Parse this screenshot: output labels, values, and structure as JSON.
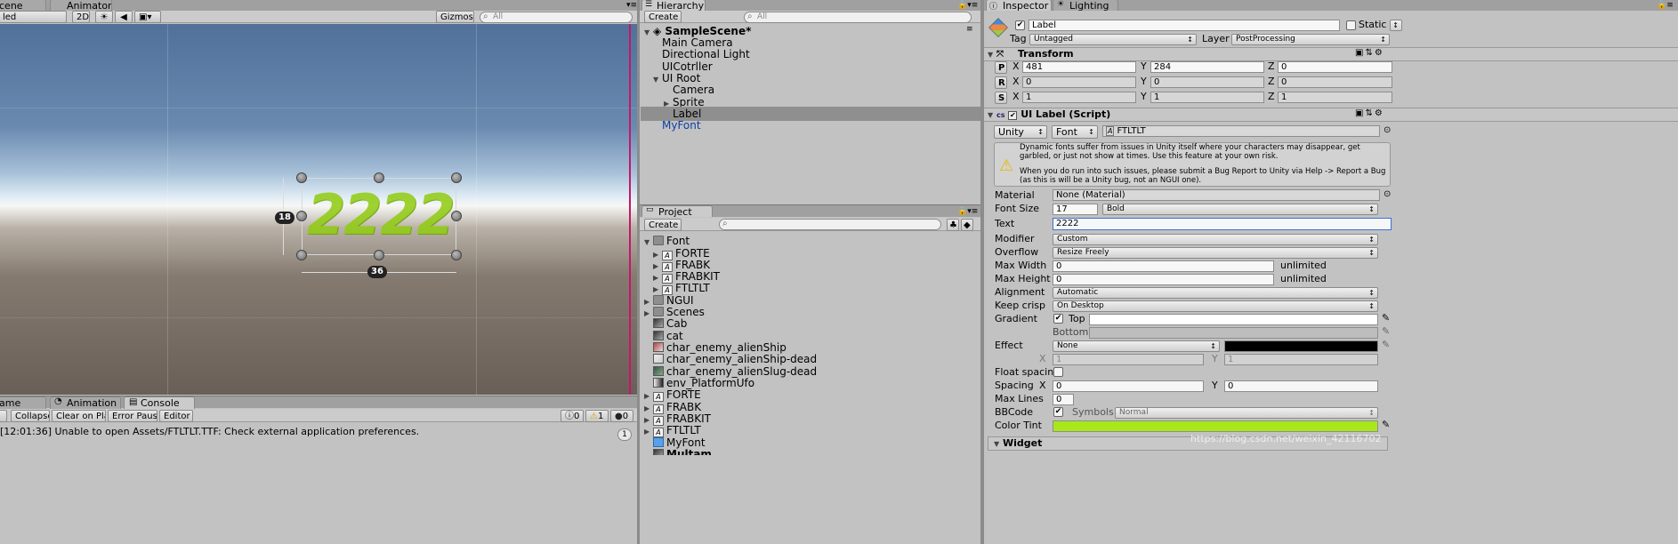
{
  "scene": {
    "tabs": [
      "cene",
      "Animator"
    ],
    "shading": "led",
    "btn_2d": "2D",
    "gizmos": "Gizmos",
    "search_placeholder": "All",
    "label_text": "2222",
    "height_badge": "18",
    "width_badge": "36"
  },
  "console": {
    "tabs": [
      "ame",
      "Animation",
      "Console"
    ],
    "buttons": [
      "Collapse",
      "Clear on Play",
      "Error Pause",
      "Editor"
    ],
    "count_info": "0",
    "count_warn": "1",
    "count_err": "0",
    "message": "[12:01:36] Unable to open Assets/FTLTLT.TTF: Check external application preferences.",
    "message_count": "1"
  },
  "hierarchy": {
    "tab": "Hierarchy",
    "create": "Create",
    "search_placeholder": "All",
    "scene_name": "SampleScene*",
    "items": [
      "Main Camera",
      "Directional Light",
      "UICotrller",
      "UI Root",
      "Camera",
      "Sprite",
      "Label",
      "MyFont"
    ]
  },
  "project": {
    "tab": "Project",
    "create": "Create",
    "items": [
      "Font",
      "FORTE",
      "FRABK",
      "FRABKIT",
      "FTLTLT",
      "NGUI",
      "Scenes",
      "Cab",
      "cat",
      "char_enemy_alienShip",
      "char_enemy_alienShip-dead",
      "char_enemy_alienSlug-dead",
      "env_PlatformUfo",
      "FORTE",
      "FRABK",
      "FRABKIT",
      "FTLTLT",
      "MyFont",
      "Multam"
    ]
  },
  "inspector": {
    "tabs": [
      "Inspector",
      "Lighting"
    ],
    "object_name": "Label",
    "static_label": "Static",
    "tag_label": "Tag",
    "tag_value": "Untagged",
    "layer_label": "Layer",
    "layer_value": "PostProcessing",
    "transform": {
      "title": "Transform",
      "rows": [
        {
          "btn": "P",
          "x": "481",
          "y": "284",
          "z": "0"
        },
        {
          "btn": "R",
          "x": "0",
          "y": "0",
          "z": "0"
        },
        {
          "btn": "S",
          "x": "1",
          "y": "1",
          "z": "1"
        }
      ]
    },
    "uilabel": {
      "title": "UI Label (Script)",
      "font_type": "Unity",
      "font_btn": "Font",
      "font_value": "FTLTLT",
      "warning_1": "Dynamic fonts suffer from issues in Unity itself where your characters may disappear, get garbled, or just not show at times. Use this feature at your own risk.",
      "warning_2": "When you do run into such issues, please submit a Bug Report to Unity via Help -> Report a Bug (as this is will be a Unity bug, not an NGUI one).",
      "material_label": "Material",
      "material_value": "None (Material)",
      "font_size_label": "Font Size",
      "font_size_value": "17",
      "font_style": "Bold",
      "text_label": "Text",
      "text_value": "2222",
      "modifier_label": "Modifier",
      "modifier_value": "Custom",
      "overflow_label": "Overflow",
      "overflow_value": "Resize Freely",
      "max_width_label": "Max Width",
      "max_width_value": "0",
      "max_width_note": "unlimited",
      "max_height_label": "Max Height",
      "max_height_value": "0",
      "max_height_note": "unlimited",
      "alignment_label": "Alignment",
      "alignment_value": "Automatic",
      "keep_crisp_label": "Keep crisp",
      "keep_crisp_value": "On Desktop",
      "gradient_label": "Gradient",
      "gradient_top": "Top",
      "gradient_bottom": "Bottom",
      "effect_label": "Effect",
      "effect_value": "None",
      "effect_x": "1",
      "effect_y": "1",
      "float_spacing_label": "Float spacing",
      "spacing_label": "Spacing",
      "spacing_x": "0",
      "spacing_y": "0",
      "max_lines_label": "Max Lines",
      "max_lines_value": "0",
      "bbcode_label": "BBCode",
      "symbols_label": "Symbols",
      "symbols_value": "Normal",
      "color_tint_label": "Color Tint",
      "color_tint": "#a8e81a"
    },
    "widget_title": "Widget",
    "watermark": "https://blog.csdn.net/weixin_42116702",
    "axis_x": "X",
    "axis_y": "Y",
    "axis_z": "Z"
  }
}
